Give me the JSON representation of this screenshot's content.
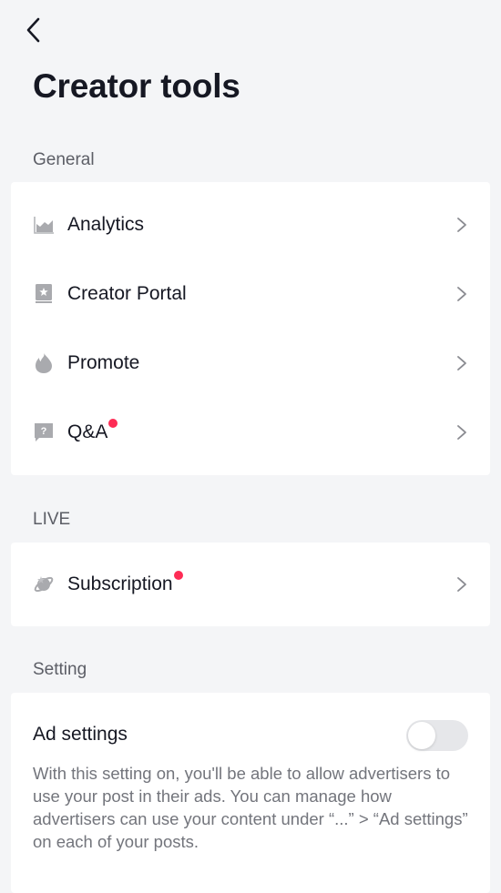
{
  "header": {
    "back_icon": "chevron-left-icon",
    "title": "Creator tools"
  },
  "colors": {
    "background": "#f4f5f7",
    "card": "#ffffff",
    "text_primary": "#161823",
    "text_secondary": "#73757c",
    "icon": "#a9aaae",
    "badge": "#fe2c55",
    "toggle_off": "#e6e7ea"
  },
  "sections": {
    "general": {
      "label": "General",
      "items": [
        {
          "label": "Analytics",
          "icon": "analytics-chart-icon",
          "badge": false
        },
        {
          "label": "Creator Portal",
          "icon": "creator-portal-book-icon",
          "badge": false
        },
        {
          "label": "Promote",
          "icon": "flame-icon",
          "badge": false
        },
        {
          "label": "Q&A",
          "icon": "question-bubble-icon",
          "badge": true
        }
      ]
    },
    "live": {
      "label": "LIVE",
      "items": [
        {
          "label": "Subscription",
          "icon": "subscription-planet-icon",
          "badge": true
        }
      ]
    },
    "setting": {
      "label": "Setting",
      "ad_settings": {
        "title": "Ad settings",
        "toggle_on": false,
        "description": "With this setting on, you'll be able to allow advertisers to use your post in their ads. You can manage how advertisers can use your content under “...” > “Ad settings” on each of your posts."
      }
    }
  }
}
